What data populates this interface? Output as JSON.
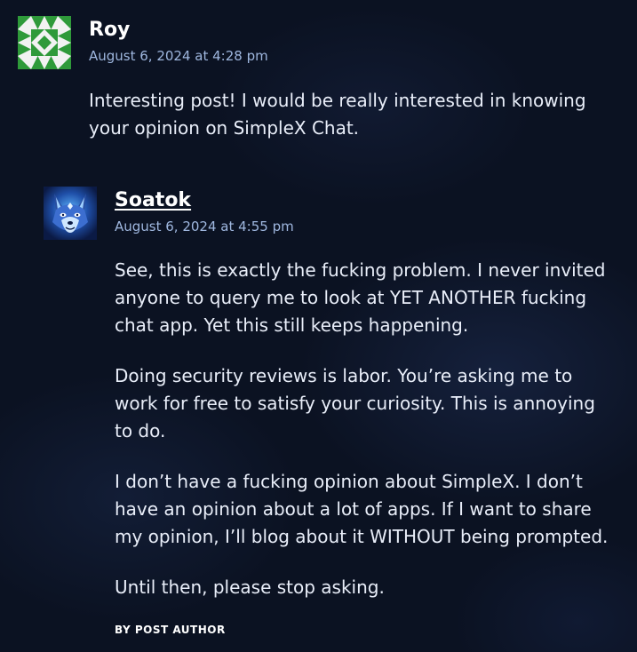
{
  "comments": [
    {
      "author": "Roy",
      "date": "August 6, 2024 at 4:28 pm",
      "avatar_icon": "identicon-avatar",
      "avatar_colors": {
        "fg": "#2f9a3a",
        "bg": "#f2f2f2"
      },
      "paragraphs": [
        "Interesting post! I would be really interested in knowing your opinion on SimpleX Chat."
      ]
    },
    {
      "author": "Soatok",
      "date": "August 6, 2024 at 4:55 pm",
      "avatar_icon": "blue-wolf-avatar",
      "paragraphs": [
        "See, this is exactly the fucking problem. I never invited anyone to query me to look at YET ANOTHER fucking chat app. Yet this still keeps happening.",
        "Doing security reviews is labor. You’re asking me to work for free to satisfy your curiosity. This is annoying to do.",
        "I don’t have a fucking opinion about SimpleX. I don’t have an opinion about a lot of apps. If I want to share my opinion, I’ll blog about it WITHOUT being prompted.",
        "Until then, please stop asking."
      ],
      "byline": "BY POST AUTHOR"
    }
  ]
}
